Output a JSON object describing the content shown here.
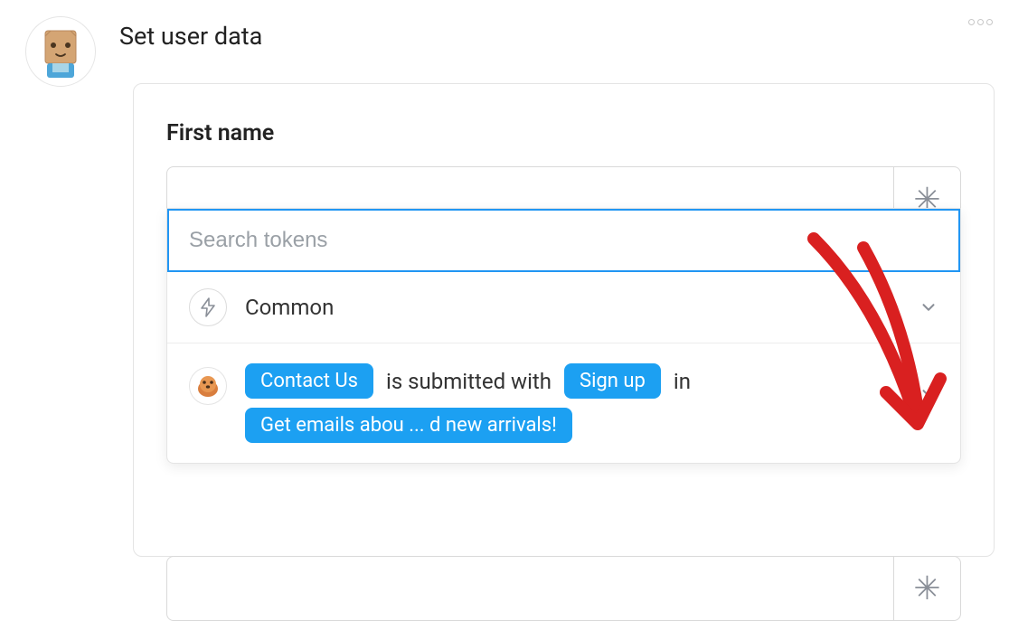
{
  "header": {
    "title": "Set user data"
  },
  "field": {
    "label": "First name"
  },
  "dropdown": {
    "search_placeholder": "Search tokens",
    "common_group_label": "Common",
    "form_row": {
      "pill_contact": "Contact Us",
      "text_submitted": " is submitted with ",
      "pill_signup": "Sign up",
      "text_in": " in",
      "pill_emails": "Get emails abou ... d new arrivals!"
    }
  }
}
